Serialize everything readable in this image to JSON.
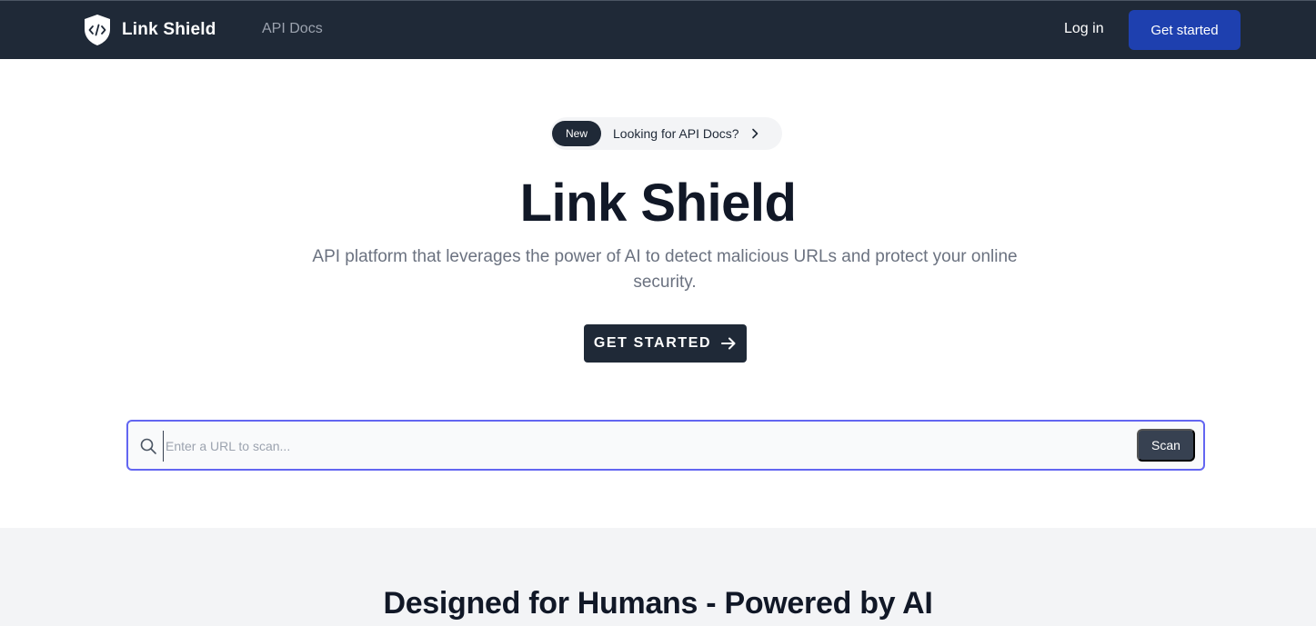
{
  "navbar": {
    "brand_name": "Link Shield",
    "links": [
      {
        "label": "API Docs"
      }
    ],
    "login_label": "Log in",
    "get_started_label": "Get started"
  },
  "hero": {
    "badge": "New",
    "announcement": "Looking for API Docs?",
    "title": "Link Shield",
    "subtitle": "API platform that leverages the power of AI to detect malicious URLs and protect your online security.",
    "cta_label": "GET STARTED"
  },
  "scan": {
    "placeholder": "Enter a URL to scan...",
    "value": "",
    "button_label": "Scan"
  },
  "features": {
    "title": "Designed for Humans - Powered by AI"
  },
  "colors": {
    "nav_bg": "#1f2937",
    "accent": "#1e40af",
    "focus_ring": "#6366f1",
    "section_bg": "#f3f4f6"
  },
  "icons": {
    "logo": "shield-code-icon",
    "pill": "chevron-right-icon",
    "cta": "arrow-right-icon",
    "scan": "search-icon"
  }
}
